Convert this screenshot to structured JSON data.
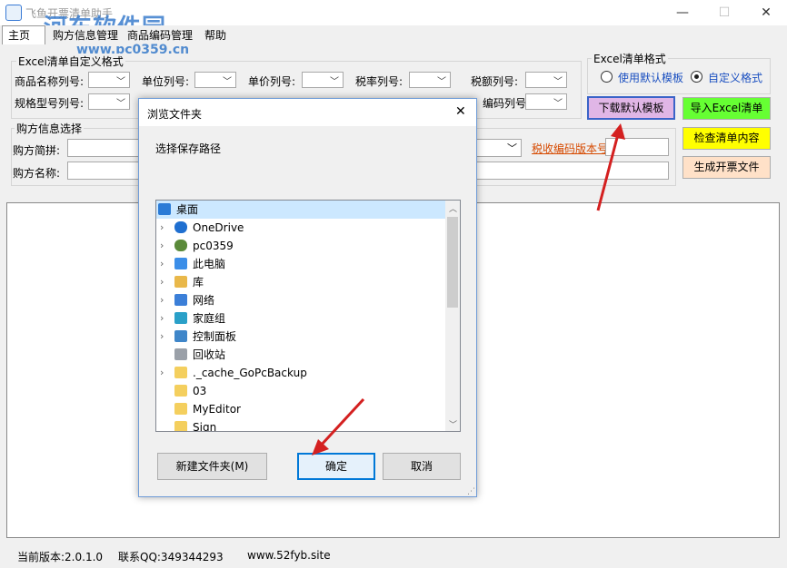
{
  "window": {
    "title": "飞鱼开票清单助手",
    "minimize": "—",
    "maximize": "☐",
    "close": "✕"
  },
  "watermark": {
    "main": "河东软件园",
    "url": "www.pc0359.cn"
  },
  "menu": {
    "items": [
      "主页",
      "购方信息管理",
      "商品编码管理",
      "帮助"
    ]
  },
  "excel_custom": {
    "legend": "Excel清单自定义格式",
    "row1": [
      "商品名称列号:",
      "单位列号:",
      "单价列号:",
      "税率列号:",
      "税额列号:"
    ],
    "row2": [
      "规格型号列号:",
      "编码列号:"
    ]
  },
  "excel_format": {
    "legend": "Excel清单格式",
    "option_default": "使用默认模板",
    "option_custom": "自定义格式"
  },
  "buttons": {
    "download": "下载默认模板",
    "import": "导入Excel清单",
    "check": "检查清单内容",
    "generate": "生成开票文件"
  },
  "buyer": {
    "legend": "购方信息选择",
    "pinyin_label": "购方简拼:",
    "name_label": "购方名称:",
    "tax_version_link": "税收编码版本号"
  },
  "status": {
    "version": "当前版本:2.0.1.0",
    "qq": "联系QQ:349344293",
    "site": "www.52fyb.site"
  },
  "dialog": {
    "title": "浏览文件夹",
    "close": "✕",
    "prompt": "选择保存路径",
    "new_folder": "新建文件夹(M)",
    "ok": "确定",
    "cancel": "取消",
    "tree": [
      {
        "label": "桌面",
        "icon": "desktop-icon",
        "color": "#2b7bd6"
      },
      {
        "label": "OneDrive",
        "icon": "cloud-icon",
        "color": "#1f6fd0"
      },
      {
        "label": "pc0359",
        "icon": "user-icon",
        "color": "#5a8a3a"
      },
      {
        "label": "此电脑",
        "icon": "computer-icon",
        "color": "#3b8ee8"
      },
      {
        "label": "库",
        "icon": "library-icon",
        "color": "#e9b84a"
      },
      {
        "label": "网络",
        "icon": "network-icon",
        "color": "#3b7fd8"
      },
      {
        "label": "家庭组",
        "icon": "homegroup-icon",
        "color": "#2aa0c8"
      },
      {
        "label": "控制面板",
        "icon": "control-panel-icon",
        "color": "#3f86c9"
      },
      {
        "label": "回收站",
        "icon": "recycle-bin-icon",
        "color": "#9aa0a8"
      },
      {
        "label": "._cache_GoPcBackup",
        "icon": "folder-icon",
        "color": "#f4cf5e"
      },
      {
        "label": "03",
        "icon": "folder-icon",
        "color": "#f4cf5e"
      },
      {
        "label": "MyEditor",
        "icon": "folder-icon",
        "color": "#f4cf5e"
      },
      {
        "label": "Sign",
        "icon": "folder-icon",
        "color": "#f4cf5e"
      }
    ]
  },
  "colors": {
    "download_bg": "#e0b6e6",
    "import_bg": "#66ff33",
    "check_bg": "#ffff00",
    "generate_bg": "#ffe1c8",
    "link": "#d64a00",
    "accent": "#0078d7"
  }
}
